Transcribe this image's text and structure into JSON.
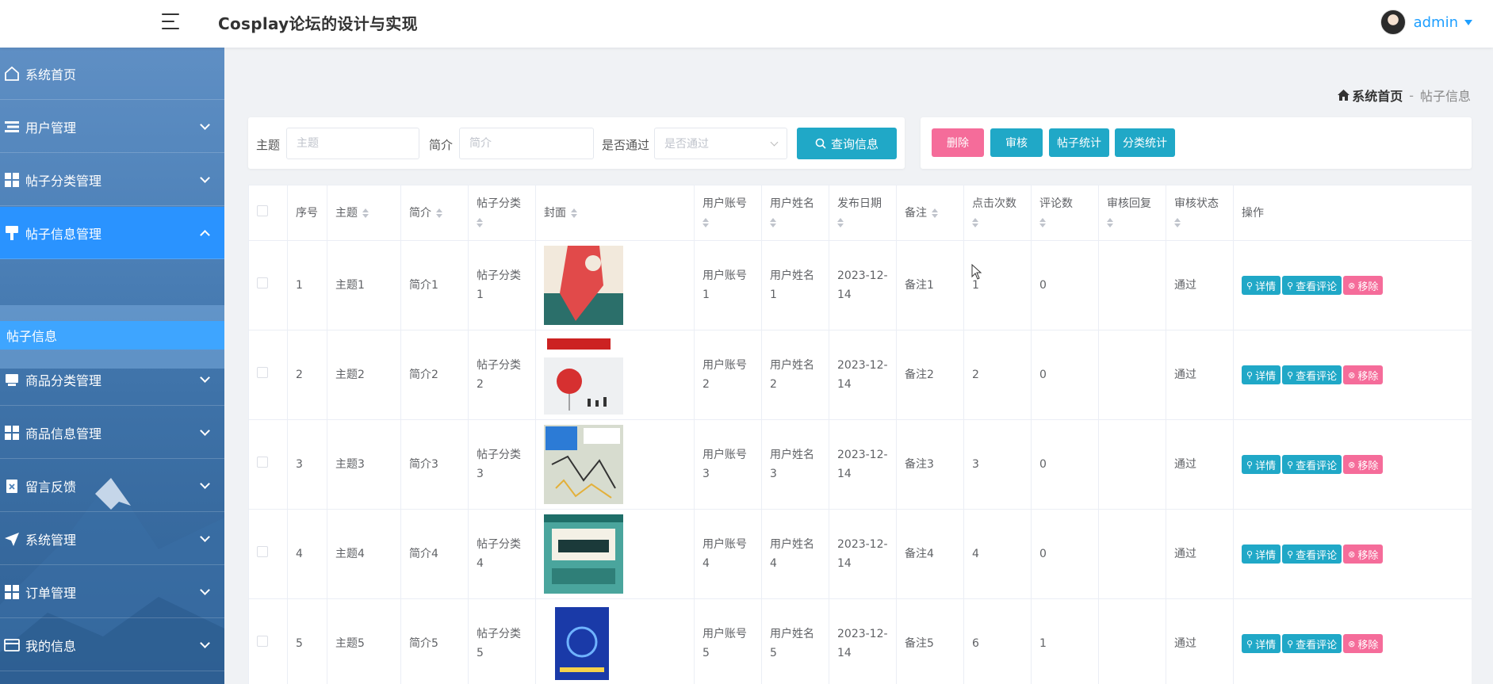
{
  "app": {
    "title": "Cosplay论坛的设计与实现",
    "user": "admin"
  },
  "sidebar": {
    "items": [
      {
        "label": "系统首页",
        "icon": "home-icon"
      },
      {
        "label": "用户管理",
        "icon": "list-icon"
      },
      {
        "label": "帖子分类管理",
        "icon": "grid-icon"
      },
      {
        "label": "帖子信息管理",
        "icon": "paint-icon",
        "expanded": true
      },
      {
        "label": "商品分类管理",
        "icon": "monitor-icon"
      },
      {
        "label": "商品信息管理",
        "icon": "grid-icon"
      },
      {
        "label": "留言反馈",
        "icon": "clipboard-icon"
      },
      {
        "label": "系统管理",
        "icon": "send-icon"
      },
      {
        "label": "订单管理",
        "icon": "grid-icon"
      },
      {
        "label": "我的信息",
        "icon": "card-icon"
      }
    ],
    "submenu": {
      "label": "帖子信息"
    }
  },
  "breadcrumb": {
    "home": "系统首页",
    "separator": "-",
    "current": "帖子信息"
  },
  "search": {
    "subject_label": "主题",
    "subject_placeholder": "主题",
    "intro_label": "简介",
    "intro_placeholder": "简介",
    "pass_label": "是否通过",
    "pass_placeholder": "是否通过",
    "query_button": "查询信息"
  },
  "actions": {
    "delete": "删除",
    "audit": "审核",
    "post_stats": "帖子统计",
    "category_stats": "分类统计"
  },
  "colors": {
    "accent": "#20a8c7",
    "danger": "#f56c9a",
    "primary": "#2a93ff"
  },
  "table": {
    "headers": [
      "序号",
      "主题",
      "简介",
      "帖子分类",
      "封面",
      "用户账号",
      "用户姓名",
      "发布日期",
      "备注",
      "点击次数",
      "评论数",
      "审核回复",
      "审核状态",
      "操作"
    ],
    "rows": [
      {
        "index": "1",
        "subject": "主题1",
        "intro": "简介1",
        "category": "帖子分类1",
        "account": "用户账号1",
        "name": "用户姓名1",
        "date": "2023-12-14",
        "remark": "备注1",
        "clicks": "1",
        "comments": "0",
        "reply": "",
        "status": "通过"
      },
      {
        "index": "2",
        "subject": "主题2",
        "intro": "简介2",
        "category": "帖子分类2",
        "account": "用户账号2",
        "name": "用户姓名2",
        "date": "2023-12-14",
        "remark": "备注2",
        "clicks": "2",
        "comments": "0",
        "reply": "",
        "status": "通过"
      },
      {
        "index": "3",
        "subject": "主题3",
        "intro": "简介3",
        "category": "帖子分类3",
        "account": "用户账号3",
        "name": "用户姓名3",
        "date": "2023-12-14",
        "remark": "备注3",
        "clicks": "3",
        "comments": "0",
        "reply": "",
        "status": "通过"
      },
      {
        "index": "4",
        "subject": "主题4",
        "intro": "简介4",
        "category": "帖子分类4",
        "account": "用户账号4",
        "name": "用户姓名4",
        "date": "2023-12-14",
        "remark": "备注4",
        "clicks": "4",
        "comments": "0",
        "reply": "",
        "status": "通过"
      },
      {
        "index": "5",
        "subject": "主题5",
        "intro": "简介5",
        "category": "帖子分类5",
        "account": "用户账号5",
        "name": "用户姓名5",
        "date": "2023-12-14",
        "remark": "备注5",
        "clicks": "6",
        "comments": "1",
        "reply": "",
        "status": "通过"
      }
    ],
    "row_actions": {
      "detail": "详情",
      "view_comments": "查看评论",
      "remove": "移除"
    }
  }
}
